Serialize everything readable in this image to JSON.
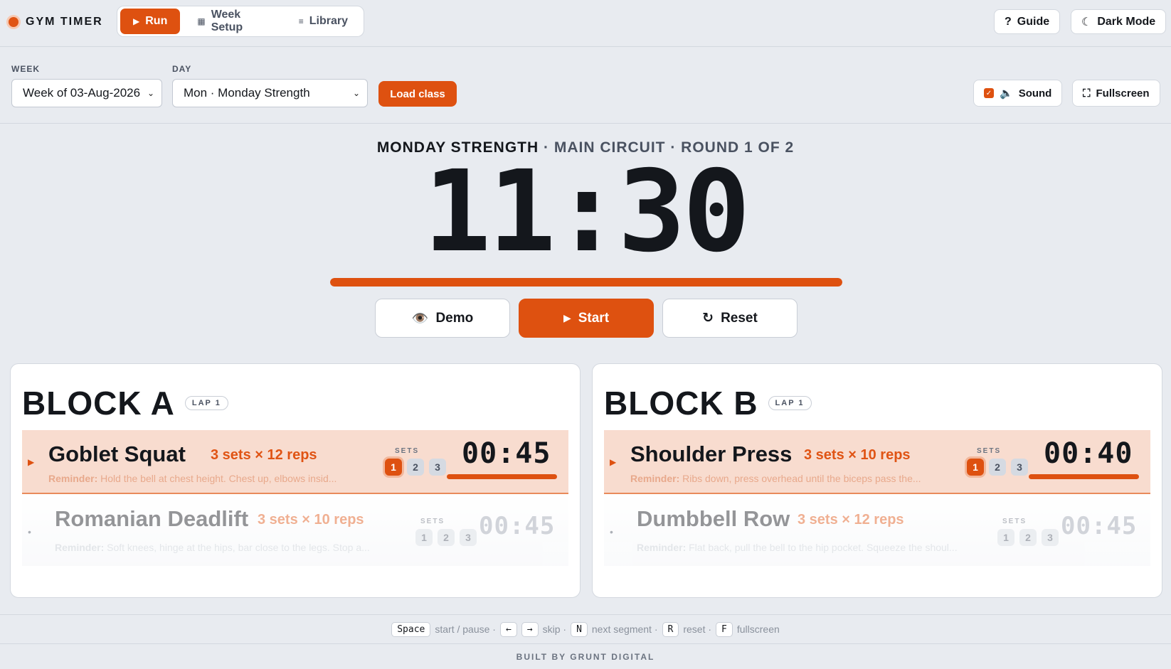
{
  "app": {
    "title": "GYM TIMER"
  },
  "nav": {
    "tabs": [
      {
        "label": "Run",
        "icon": "play-icon",
        "glyph": "▶"
      },
      {
        "label": "Week Setup",
        "icon": "grid-icon",
        "glyph": "▦"
      },
      {
        "label": "Library",
        "icon": "list-icon",
        "glyph": "≡"
      }
    ],
    "guide_label": "Guide",
    "guide_glyph": "?",
    "darkmode_label": "Dark Mode",
    "darkmode_glyph": "☾"
  },
  "controls": {
    "week_label": "WEEK",
    "week_value": "Week of 03-Aug-2026",
    "day_label": "DAY",
    "day_value": "Mon · Monday Strength",
    "load_label": "Load class",
    "sound_label": "Sound",
    "sound_glyph": "🔈",
    "sound_checked": true,
    "fullscreen_label": "Fullscreen",
    "fullscreen_glyph": "⛶"
  },
  "session": {
    "class_name": "MONDAY STRENGTH",
    "segment": "· MAIN CIRCUIT · ROUND 1 OF 2",
    "time": "11:30",
    "progress": 1.0
  },
  "actions": {
    "demo_label": "Demo",
    "demo_glyph": "👁️",
    "start_label": "Start",
    "start_glyph": "▶",
    "reset_label": "Reset",
    "reset_glyph": "↻"
  },
  "blocks": [
    {
      "title": "BLOCK A",
      "lap": "LAP 1",
      "active": {
        "marker": "▶",
        "name": "Goblet Squat",
        "scheme": "3 sets × 12 reps",
        "reminder_label": "Reminder:",
        "reminder_text": "Hold the bell at chest height. Chest up, elbows insid...",
        "sets_label": "SETS",
        "sets": [
          "1",
          "2",
          "3"
        ],
        "current_set": 1,
        "time": "00:45",
        "progress": 1.0
      },
      "next": {
        "marker": "•",
        "name": "Romanian Deadlift",
        "scheme": "3 sets × 10 reps",
        "reminder_label": "Reminder:",
        "reminder_text": "Soft knees, hinge at the hips, bar close to the legs. Stop a...",
        "sets_label": "SETS",
        "sets": [
          "1",
          "2",
          "3"
        ],
        "time": "00:45"
      }
    },
    {
      "title": "BLOCK B",
      "lap": "LAP 1",
      "active": {
        "marker": "▶",
        "name": "Shoulder Press",
        "scheme": "3 sets × 10 reps",
        "reminder_label": "Reminder:",
        "reminder_text": "Ribs down, press overhead until the biceps pass the...",
        "sets_label": "SETS",
        "sets": [
          "1",
          "2",
          "3"
        ],
        "current_set": 1,
        "time": "00:40",
        "progress": 1.0
      },
      "next": {
        "marker": "•",
        "name": "Dumbbell Row",
        "scheme": "3 sets × 12 reps",
        "reminder_label": "Reminder:",
        "reminder_text": "Flat back, pull the bell to the hip pocket. Squeeze the shoul...",
        "sets_label": "SETS",
        "sets": [
          "1",
          "2",
          "3"
        ],
        "time": "00:45"
      }
    }
  ],
  "shortcuts": [
    {
      "keys": [
        "Space"
      ],
      "desc": "start / pause ·"
    },
    {
      "keys": [
        "←",
        "→"
      ],
      "desc": "skip ·"
    },
    {
      "keys": [
        "N"
      ],
      "desc": "next segment ·"
    },
    {
      "keys": [
        "R"
      ],
      "desc": "reset ·"
    },
    {
      "keys": [
        "F"
      ],
      "desc": "fullscreen"
    }
  ],
  "footer": {
    "credit": "BUILT BY GRUNT DIGITAL"
  },
  "colors": {
    "accent": "#de5110",
    "background": "#e8ebf0"
  }
}
